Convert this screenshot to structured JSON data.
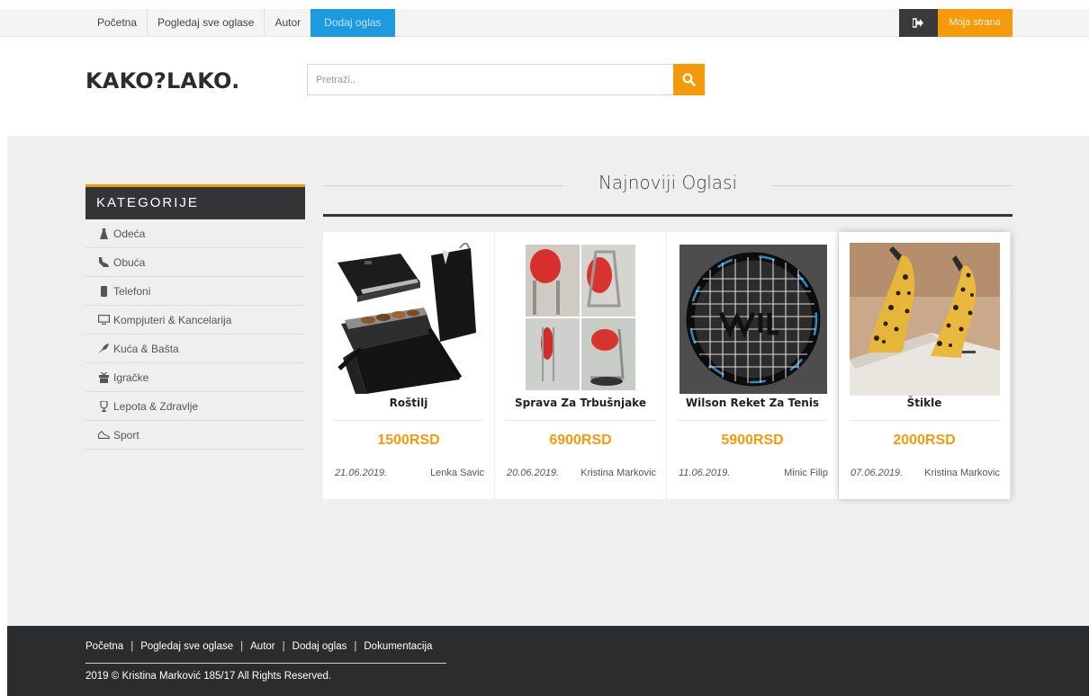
{
  "nav": {
    "items": [
      {
        "label": "Početna"
      },
      {
        "label": "Pogledaj sve oglase"
      },
      {
        "label": "Autor"
      },
      {
        "label": "Dodaj oglas"
      }
    ],
    "my_page": "Moja strana",
    "logout_icon": "sign-out-icon"
  },
  "header": {
    "logo": "KAKO?LAKO.",
    "search_placeholder": "Pretraži..",
    "search_icon": "search-icon"
  },
  "sidebar": {
    "title": "KATEGORIJE",
    "items": [
      {
        "label": "Odeća",
        "icon": "dress-icon"
      },
      {
        "label": "Obuća",
        "icon": "shoe-icon"
      },
      {
        "label": "Telefoni",
        "icon": "phone-icon"
      },
      {
        "label": "Kompjuteri & Kancelarija",
        "icon": "monitor-icon"
      },
      {
        "label": "Kuća & Bašta",
        "icon": "plant-icon"
      },
      {
        "label": "Igračke",
        "icon": "gift-icon"
      },
      {
        "label": "Lepota & Zdravlje",
        "icon": "trophy-icon"
      },
      {
        "label": "Sport",
        "icon": "sneaker-icon"
      }
    ]
  },
  "section": {
    "title": "Najnoviji Oglasi"
  },
  "ads": [
    {
      "name": "Roštilj",
      "price": "1500RSD",
      "date": "21.06.2019.",
      "author": "Lenka Savic",
      "image": "grill-image"
    },
    {
      "name": "Sprava Za Trbušnjake",
      "price": "6900RSD",
      "date": "20.06.2019.",
      "author": "Kristina Markovic",
      "image": "ab-machine-image"
    },
    {
      "name": "Wilson Reket Za Tenis",
      "price": "5900RSD",
      "date": "11.06.2019.",
      "author": "Minic Filip",
      "image": "tennis-racket-image"
    },
    {
      "name": "Štikle",
      "price": "2000RSD",
      "date": "07.06.2019.",
      "author": "Kristina Markovic",
      "image": "heels-image"
    }
  ],
  "footer": {
    "links": [
      {
        "label": "Početna"
      },
      {
        "label": "Pogledaj sve oglase"
      },
      {
        "label": "Autor"
      },
      {
        "label": "Dodaj oglas"
      },
      {
        "label": "Dokumentacija"
      }
    ],
    "separator": "|",
    "copyright": "2019 © Kristina Marković 185/17 All Rights Reserved."
  },
  "colors": {
    "accent": "#f59a0b",
    "active_nav": "#1e9be0",
    "dark": "#333537"
  }
}
